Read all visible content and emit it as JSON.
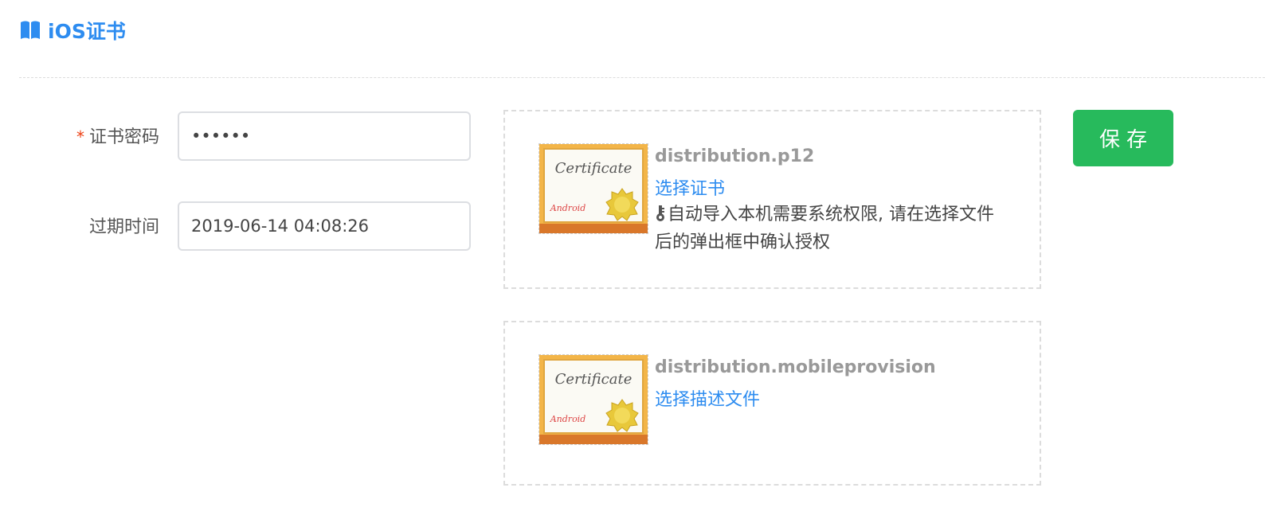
{
  "header": {
    "title": "iOS证书",
    "icon": "book-icon",
    "color": "#2d8cf0"
  },
  "form": {
    "password": {
      "required_mark": "*",
      "label": "证书密码",
      "value": "••••••"
    },
    "expiry": {
      "label": "过期时间",
      "value": "2019-06-14 04:08:26"
    }
  },
  "p12_card": {
    "file_name": "distribution.p12",
    "choose_label": "选择证书",
    "tip_icon": "key-icon",
    "tip": "自动导入本机需要系统权限, 请在选择文件后的弹出框中确认授权",
    "thumb": {
      "title": "Certificate",
      "sub": "Android"
    }
  },
  "provision_card": {
    "file_name": "distribution.mobileprovision",
    "choose_label": "选择描述文件",
    "thumb": {
      "title": "Certificate",
      "sub": "Android"
    }
  },
  "save_button": {
    "label": "保存",
    "color": "#27ba5c"
  }
}
